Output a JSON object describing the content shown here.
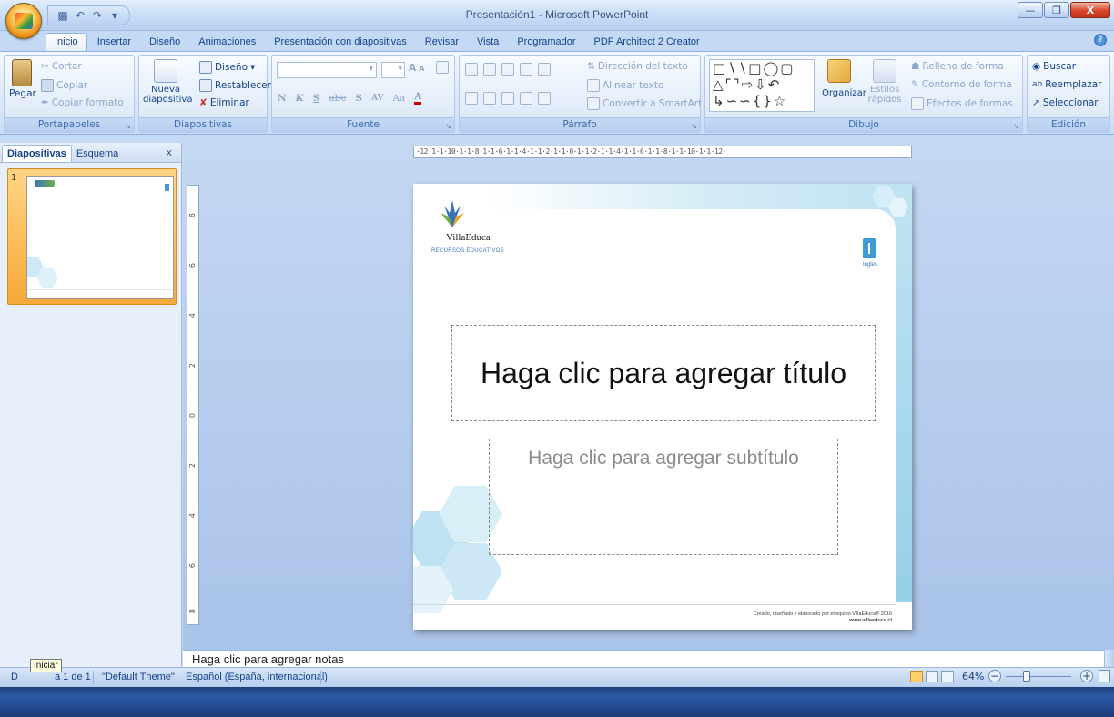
{
  "window": {
    "title": "Presentación1 - Microsoft PowerPoint"
  },
  "tabs": [
    "Inicio",
    "Insertar",
    "Diseño",
    "Animaciones",
    "Presentación con diapositivas",
    "Revisar",
    "Vista",
    "Programador",
    "PDF Architect 2 Creator"
  ],
  "ribbon": {
    "clipboard": {
      "label": "Portapapeles",
      "paste": "Pegar",
      "cut": "Cortar",
      "copy": "Copiar",
      "format_painter": "Copiar formato"
    },
    "slides": {
      "label": "Diapositivas",
      "new_slide": "Nueva diapositiva",
      "layout": "Diseño",
      "reset": "Restablecer",
      "delete": "Eliminar"
    },
    "font": {
      "label": "Fuente",
      "bold": "N",
      "italic": "K",
      "underline": "S",
      "strike": "abe",
      "shadow": "S",
      "spacing": "AV",
      "case": "Aa",
      "color": "A",
      "grow": "A",
      "shrink": "A"
    },
    "paragraph": {
      "label": "Párrafo",
      "text_direction": "Dirección del texto",
      "align_text": "Alinear texto",
      "smartart": "Convertir a SmartArt"
    },
    "drawing": {
      "label": "Dibujo",
      "arrange": "Organizar",
      "quick_styles": "Estilos rápidos",
      "shape_fill": "Relleno de forma",
      "shape_outline": "Contorno de forma",
      "shape_effects": "Efectos de formas"
    },
    "editing": {
      "label": "Edición",
      "find": "Buscar",
      "replace": "Reemplazar",
      "select": "Seleccionar"
    }
  },
  "left_pane": {
    "tab_slides": "Diapositivas",
    "tab_outline": "Esquema",
    "close": "x",
    "slide_number": "1"
  },
  "ruler": {
    "horizontal": "·12·1·1·10·1·1·8·1·1·6·1·1·4·1·1·2·1·1·0·1·1·2·1·1·4·1·1·6·1·1·8·1·1·10·1·1·12·",
    "vertical": [
      "8",
      "6",
      "4",
      "2",
      "0",
      "2",
      "4",
      "6",
      "8"
    ]
  },
  "slide": {
    "logo_name": "VillaEduca",
    "logo_subtitle": "RECURSOS EDUCATIVOS",
    "language_label": "Inglés",
    "title_placeholder": "Haga clic para agregar título",
    "subtitle_placeholder": "Haga clic para agregar subtítulo",
    "credit_line1": "Creado, diseñado y elaborado por el equipo VillaEduca® 2016",
    "credit_line2": "www.villaeduca.cl"
  },
  "notes": {
    "placeholder": "Haga clic para agregar notas"
  },
  "status": {
    "slide_info_prefix": "D",
    "slide_info": "a 1 de 1",
    "theme": "\"Default Theme\"",
    "language": "Español (España, internacional)",
    "zoom": "64%",
    "tooltip": "Iniciar"
  },
  "colors": {
    "ribbon_text": "#15428b",
    "accent_orange": "#f7a93a",
    "slide_accent": "#3e9bd6"
  }
}
